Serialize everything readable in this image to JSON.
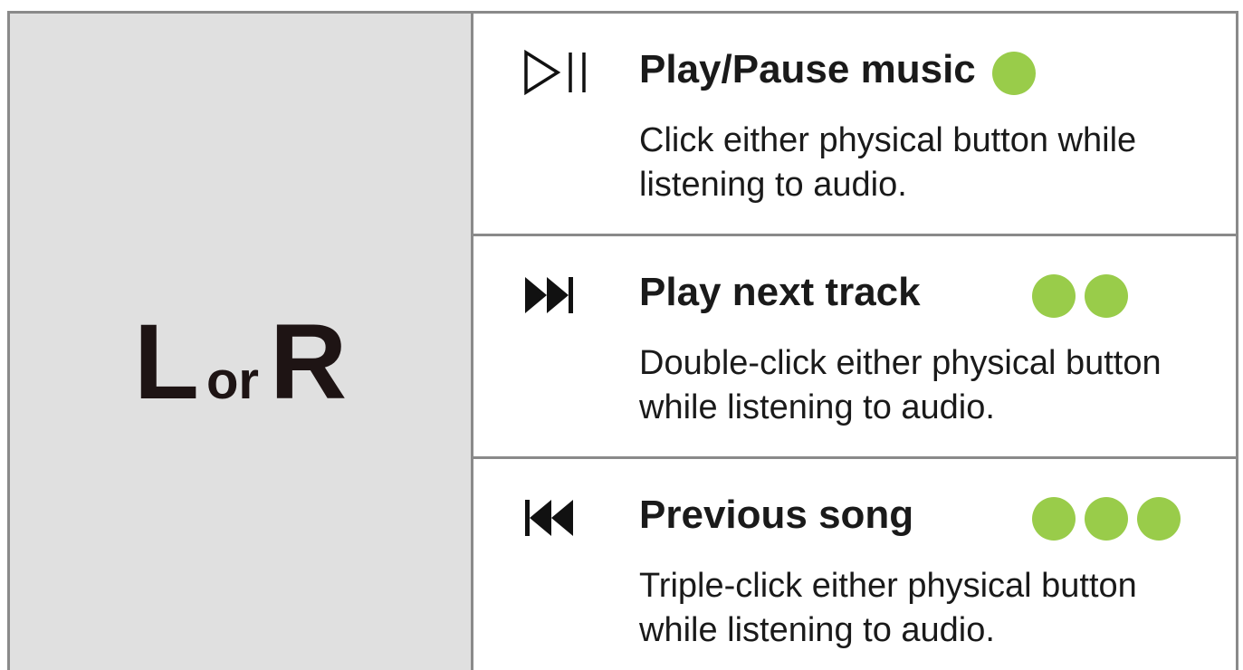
{
  "side_label": {
    "left": "L",
    "connector": "or",
    "right": "R"
  },
  "actions": [
    {
      "icon": "play-pause-icon",
      "title": "Play/Pause music",
      "description": "Click either physical button while listening to audio.",
      "click_count": 1
    },
    {
      "icon": "next-track-icon",
      "title": "Play next track",
      "description": "Double-click either physical button while listening to audio.",
      "click_count": 2
    },
    {
      "icon": "previous-track-icon",
      "title": "Previous song",
      "description": "Triple-click either physical button while listening to audio.",
      "click_count": 3
    }
  ],
  "colors": {
    "dot": "#99cc4a",
    "border": "#8a8a8a",
    "left_panel_bg": "#e0e0e0"
  }
}
